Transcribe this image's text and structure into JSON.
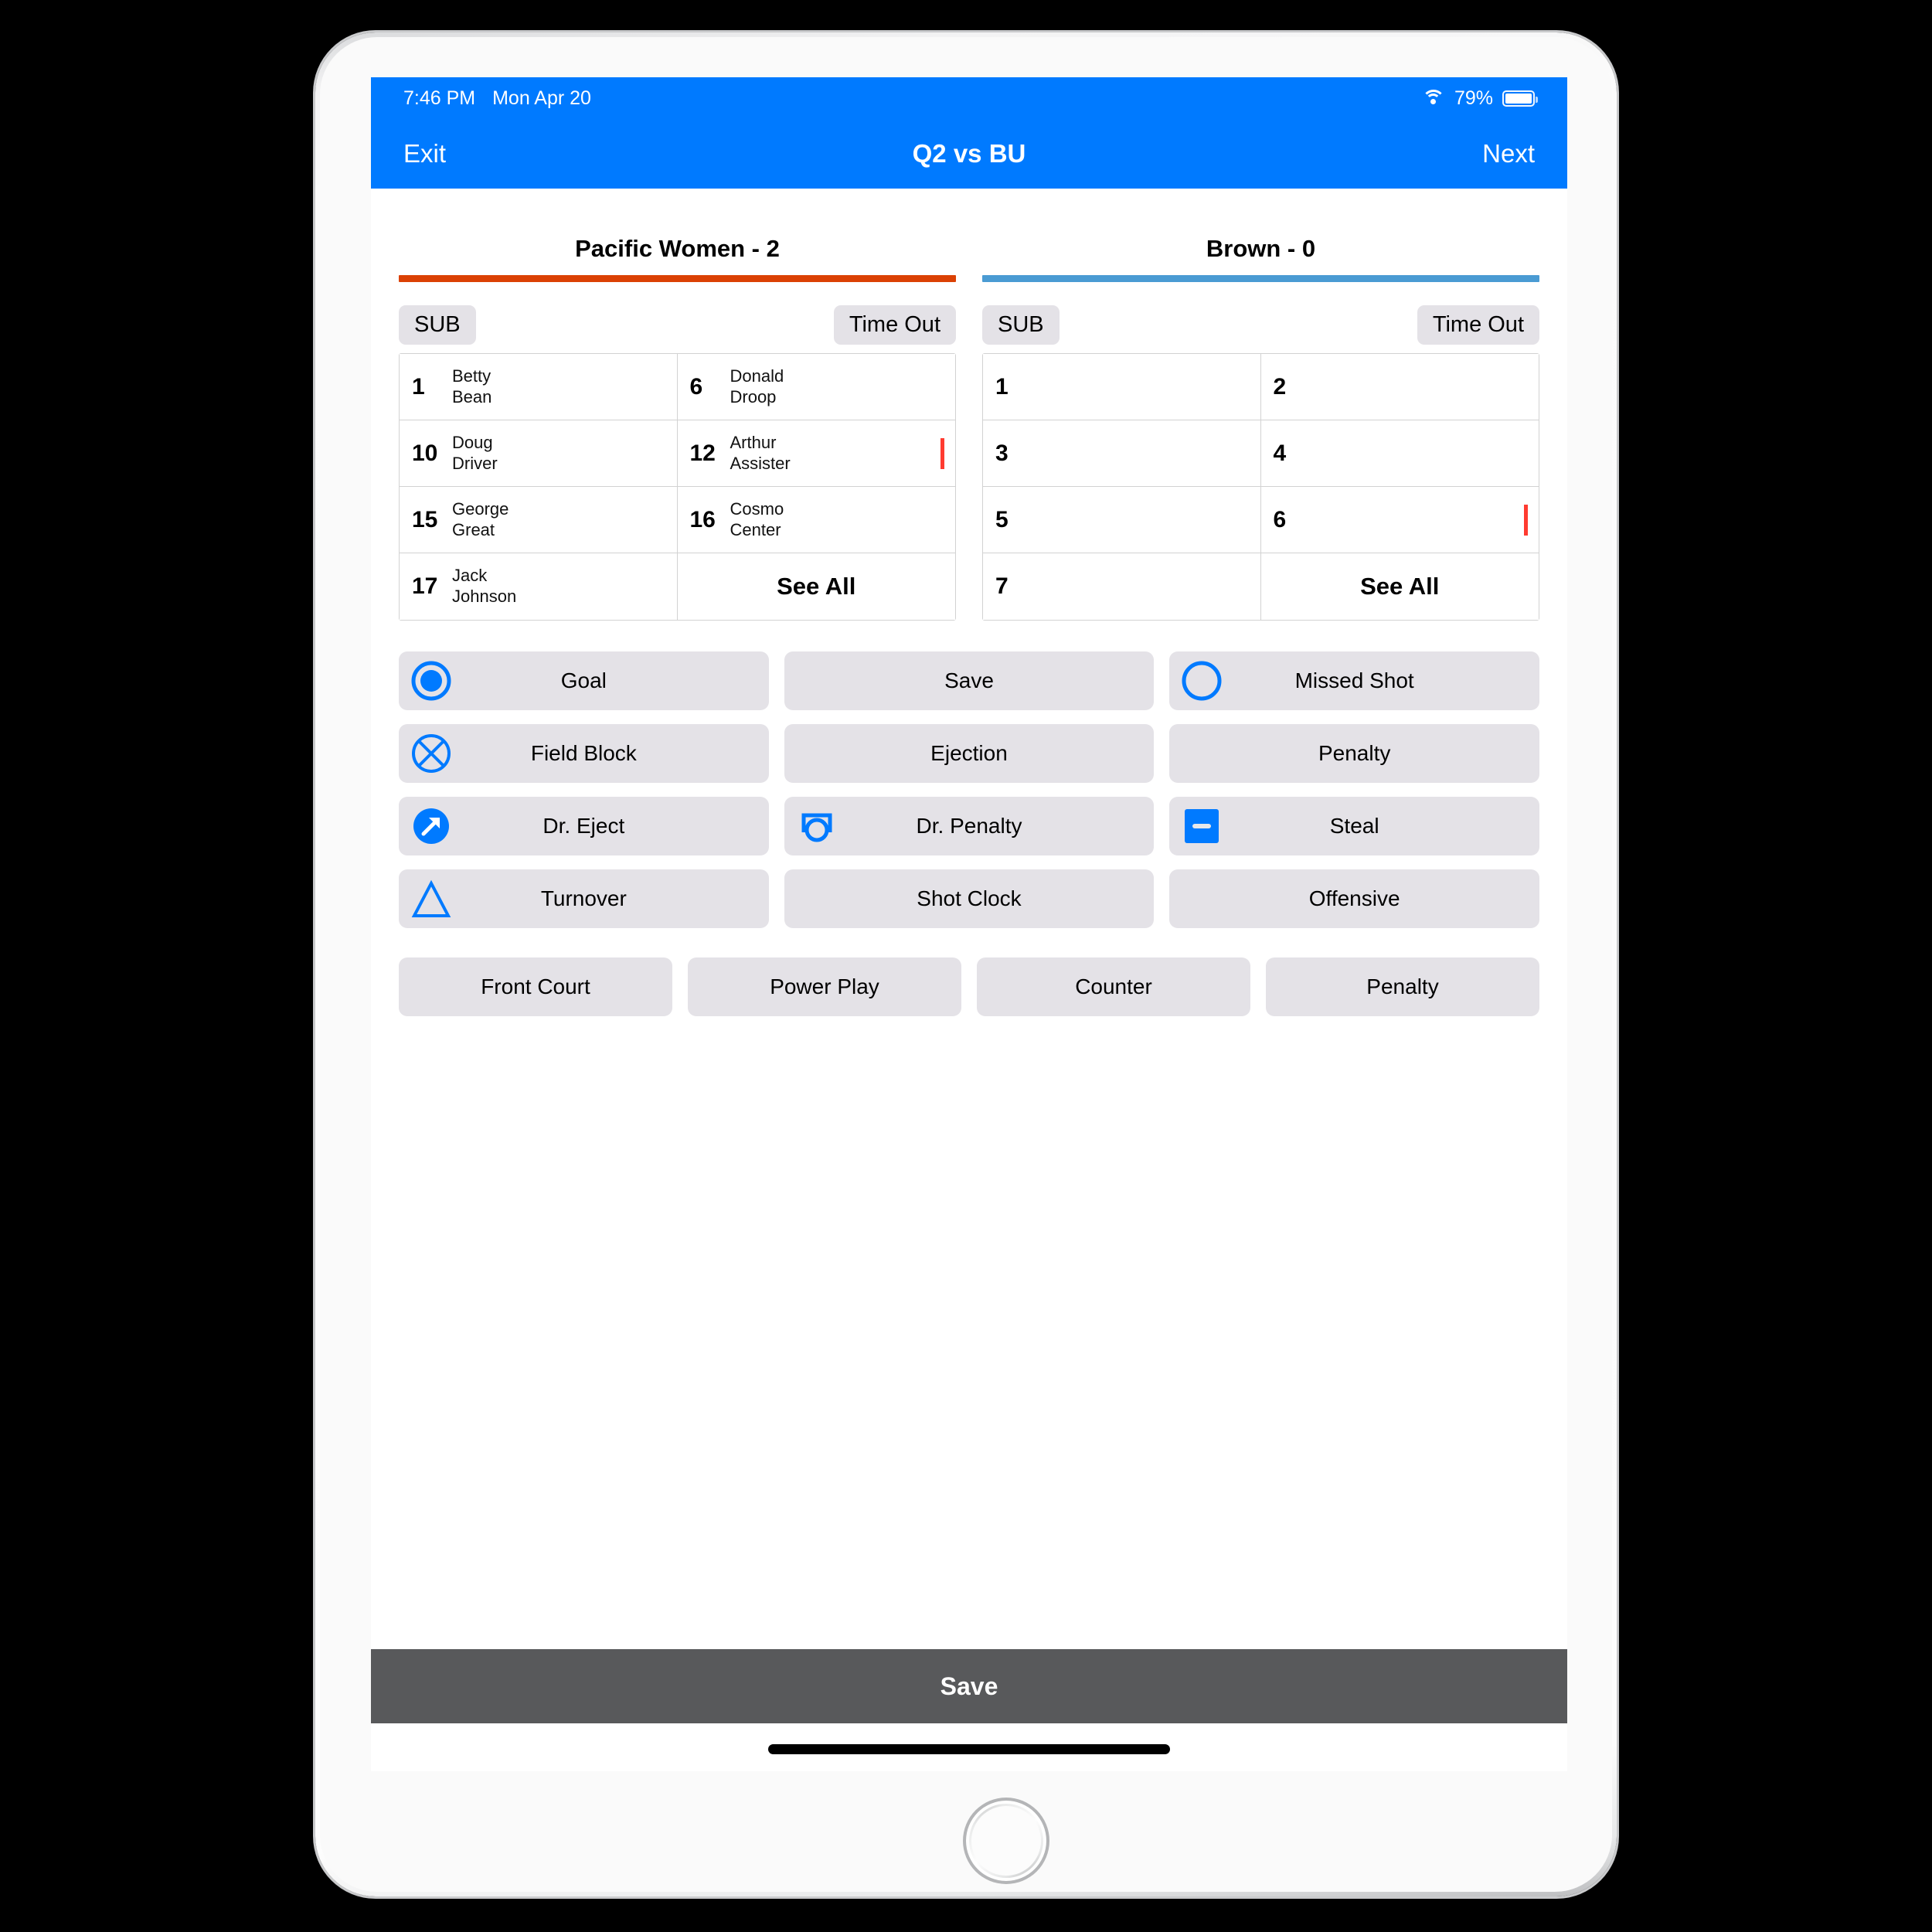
{
  "status_bar": {
    "time": "7:46 PM",
    "date": "Mon Apr 20",
    "battery_percent": "79%",
    "wifi_icon": "wifi-icon",
    "battery_icon": "battery-icon"
  },
  "nav_bar": {
    "left_label": "Exit",
    "title": "Q2 vs BU",
    "right_label": "Next",
    "background_color": "#007AFF"
  },
  "teams": [
    {
      "title": "Pacific Women - 2",
      "name": "Pacific Women",
      "score": "2",
      "accent_color": "#DB4104",
      "sub_label": "SUB",
      "timeout_label": "Time Out",
      "see_all_label": "See All",
      "roster": [
        {
          "number": "1",
          "first": "Betty",
          "last": "Bean",
          "flag": false
        },
        {
          "number": "6",
          "first": "Donald",
          "last": "Droop",
          "flag": false
        },
        {
          "number": "10",
          "first": "Doug",
          "last": "Driver",
          "flag": false
        },
        {
          "number": "12",
          "first": "Arthur",
          "last": "Assister",
          "flag": true
        },
        {
          "number": "15",
          "first": "George",
          "last": "Great",
          "flag": false
        },
        {
          "number": "16",
          "first": "Cosmo",
          "last": "Center",
          "flag": false
        },
        {
          "number": "17",
          "first": "Jack",
          "last": "Johnson",
          "flag": false
        }
      ]
    },
    {
      "title": "Brown - 0",
      "name": "Brown",
      "score": "0",
      "accent_color": "#4A9BD3",
      "sub_label": "SUB",
      "timeout_label": "Time Out",
      "see_all_label": "See All",
      "roster": [
        {
          "number": "1",
          "first": "",
          "last": "",
          "flag": false
        },
        {
          "number": "2",
          "first": "",
          "last": "",
          "flag": false
        },
        {
          "number": "3",
          "first": "",
          "last": "",
          "flag": false
        },
        {
          "number": "4",
          "first": "",
          "last": "",
          "flag": false
        },
        {
          "number": "5",
          "first": "",
          "last": "",
          "flag": false
        },
        {
          "number": "6",
          "first": "",
          "last": "",
          "flag": true
        },
        {
          "number": "7",
          "first": "",
          "last": "",
          "flag": false
        }
      ]
    }
  ],
  "actions": [
    {
      "label": "Goal",
      "icon": "filled-circle-in-ring-icon"
    },
    {
      "label": "Save",
      "icon": "none"
    },
    {
      "label": "Missed Shot",
      "icon": "open-circle-icon"
    },
    {
      "label": "Field Block",
      "icon": "circle-x-icon"
    },
    {
      "label": "Ejection",
      "icon": "none"
    },
    {
      "label": "Penalty",
      "icon": "none"
    },
    {
      "label": "Dr. Eject",
      "icon": "filled-circle-arrow-icon"
    },
    {
      "label": "Dr. Penalty",
      "icon": "goal-post-circle-icon"
    },
    {
      "label": "Steal",
      "icon": "filled-square-minus-icon"
    },
    {
      "label": "Turnover",
      "icon": "triangle-outline-icon"
    },
    {
      "label": "Shot Clock",
      "icon": "none"
    },
    {
      "label": "Offensive",
      "icon": "none"
    }
  ],
  "modes": [
    {
      "label": "Front Court"
    },
    {
      "label": "Power Play"
    },
    {
      "label": "Counter"
    },
    {
      "label": "Penalty"
    }
  ],
  "footer": {
    "save_label": "Save"
  },
  "colors": {
    "accent_blue": "#007AFF",
    "button_gray": "#E4E2E7",
    "save_bar_gray": "#58595B",
    "flag_red": "#FF3B30"
  }
}
